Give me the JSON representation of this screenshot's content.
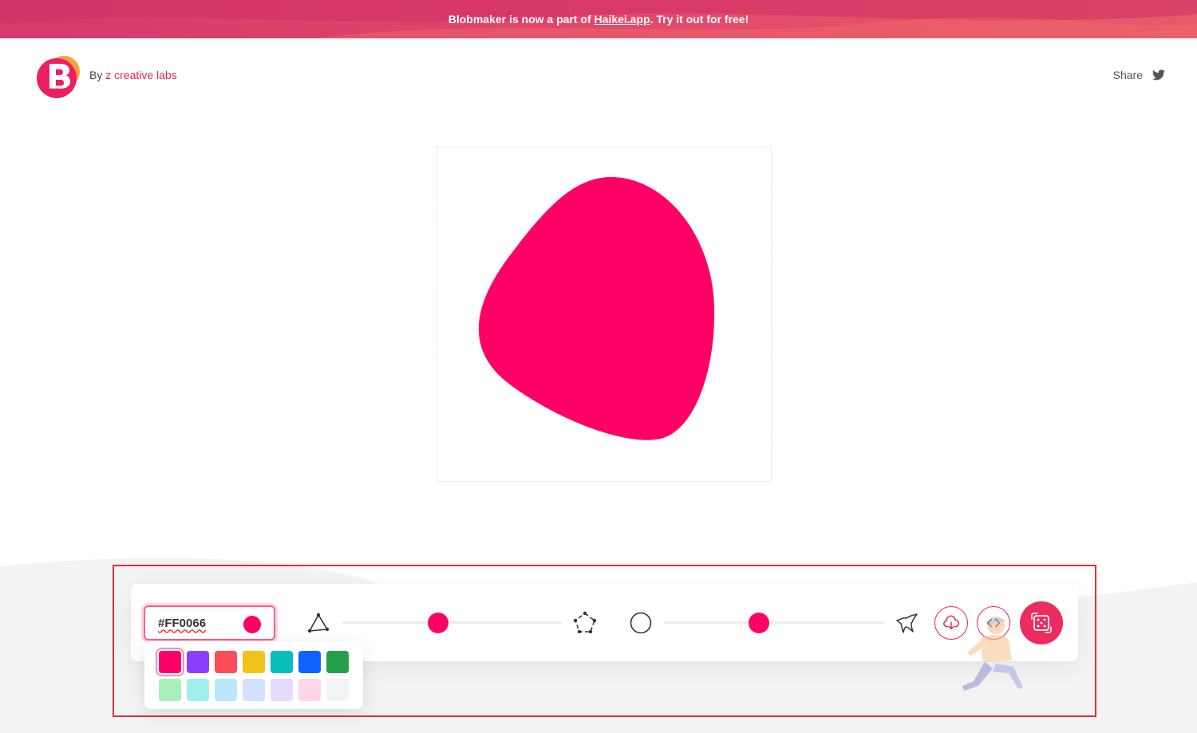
{
  "banner": {
    "prefix": "Blobmaker is now a part of ",
    "link": "Haikei.app",
    "suffix": ". Try it out for free!"
  },
  "header": {
    "logo_letter": "B",
    "by": "By ",
    "lab": "z creative labs",
    "share_label": "Share",
    "share_icon": "twitter-icon"
  },
  "blob": {
    "fill": "#FF0066"
  },
  "controls": {
    "color_value": "#FF0066",
    "complexity_value": 0.44,
    "contrast_value": 0.43,
    "icons": {
      "complexity_min": "triangle-nodes-icon",
      "complexity_max": "pentagon-nodes-icon",
      "contrast_min": "circle-outline-icon",
      "contrast_max": "spiky-shape-icon",
      "download": "download-cloud-icon",
      "code": "code-icon",
      "randomize": "dice-icon"
    }
  },
  "palette": {
    "row1": [
      "#FF0066",
      "#8A3FFC",
      "#FA4D56",
      "#F1C21B",
      "#08BDBA",
      "#0F62FE",
      "#24A148"
    ],
    "row2": [
      "#A7F0BA",
      "#9EF0F0",
      "#BAE6FF",
      "#D0E2FF",
      "#E8DAFF",
      "#FFD6E8",
      "#F2F4F8"
    ],
    "selected_index": 0
  },
  "colors": {
    "accent": "#E3245B",
    "banner": "#D6396A"
  }
}
